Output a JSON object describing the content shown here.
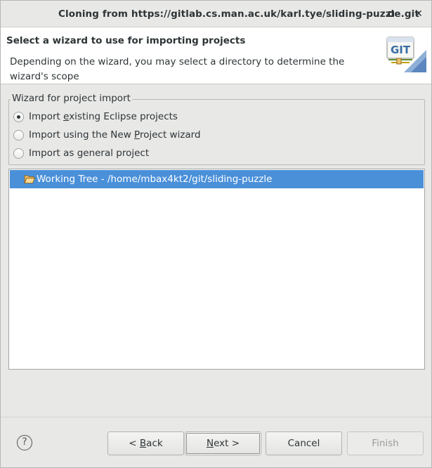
{
  "window": {
    "title": "Cloning from https://gitlab.cs.man.ac.uk/karl.tye/sliding-puzzle.git"
  },
  "banner": {
    "title": "Select a wizard to use for importing projects",
    "description": "Depending on the wizard, you may select a directory to determine the wizard's scope",
    "logo_text": "GIT"
  },
  "wizard_group": {
    "legend": "Wizard for project import",
    "options": [
      {
        "label_pre": "Import ",
        "mnemonic": "e",
        "label_post": "xisting Eclipse projects",
        "selected": true
      },
      {
        "label_pre": "Import using the New ",
        "mnemonic": "P",
        "label_post": "roject wizard",
        "selected": false
      },
      {
        "label_pre": "Import as general project",
        "mnemonic": "",
        "label_post": "",
        "selected": false
      }
    ]
  },
  "tree": {
    "items": [
      {
        "label": "Working Tree - /home/mbax4kt2/git/sliding-puzzle",
        "icon": "folder-open-icon",
        "selected": true
      }
    ]
  },
  "buttons": {
    "help": "?",
    "back_pre": "< ",
    "back_mn": "B",
    "back_post": "ack",
    "next_mn": "N",
    "next_post": "ext >",
    "cancel": "Cancel",
    "finish": "Finish"
  },
  "colors": {
    "selection": "#4a90d9",
    "window_bg": "#e8e8e7",
    "banner_bg": "#ffffff"
  }
}
